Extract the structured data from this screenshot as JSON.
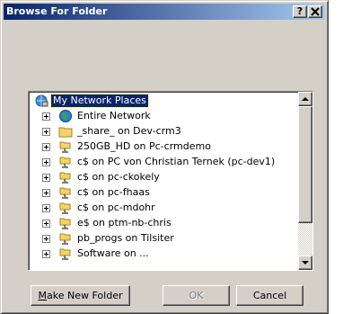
{
  "window": {
    "title": "Browse For Folder",
    "help_label": "?",
    "close_label": "✕"
  },
  "tree": {
    "items": [
      {
        "label": "My Network Places",
        "icon": "network-places-icon",
        "selected": true,
        "expandable": false
      },
      {
        "label": "Entire Network",
        "icon": "globe-icon",
        "expandable": true
      },
      {
        "label": "_share_ on Dev-crm3",
        "icon": "folder-icon",
        "expandable": true
      },
      {
        "label": "250GB_HD on Pc-crmdemo",
        "icon": "network-drive-icon",
        "expandable": true
      },
      {
        "label": "c$ on PC von Christian Ternek (pc-dev1)",
        "icon": "network-drive-icon",
        "expandable": true
      },
      {
        "label": "c$ on pc-ckokely",
        "icon": "network-drive-icon",
        "expandable": true
      },
      {
        "label": "c$ on pc-fhaas",
        "icon": "network-drive-icon",
        "expandable": true
      },
      {
        "label": "c$ on pc-mdohr",
        "icon": "network-drive-icon",
        "expandable": true
      },
      {
        "label": "e$ on ptm-nb-chris",
        "icon": "network-drive-icon",
        "expandable": true
      },
      {
        "label": "pb_progs on Tilsiter",
        "icon": "network-drive-icon",
        "expandable": true
      },
      {
        "label": "Software on ...",
        "icon": "network-drive-icon",
        "expandable": true
      }
    ]
  },
  "buttons": {
    "make_new_folder_prefix": "M",
    "make_new_folder_rest": "ake New Folder",
    "ok": "OK",
    "cancel": "Cancel"
  },
  "colors": {
    "titlebar_start": "#0a246a",
    "titlebar_end": "#a6caf0",
    "face": "#d4d0c8",
    "selection": "#0a246a"
  }
}
